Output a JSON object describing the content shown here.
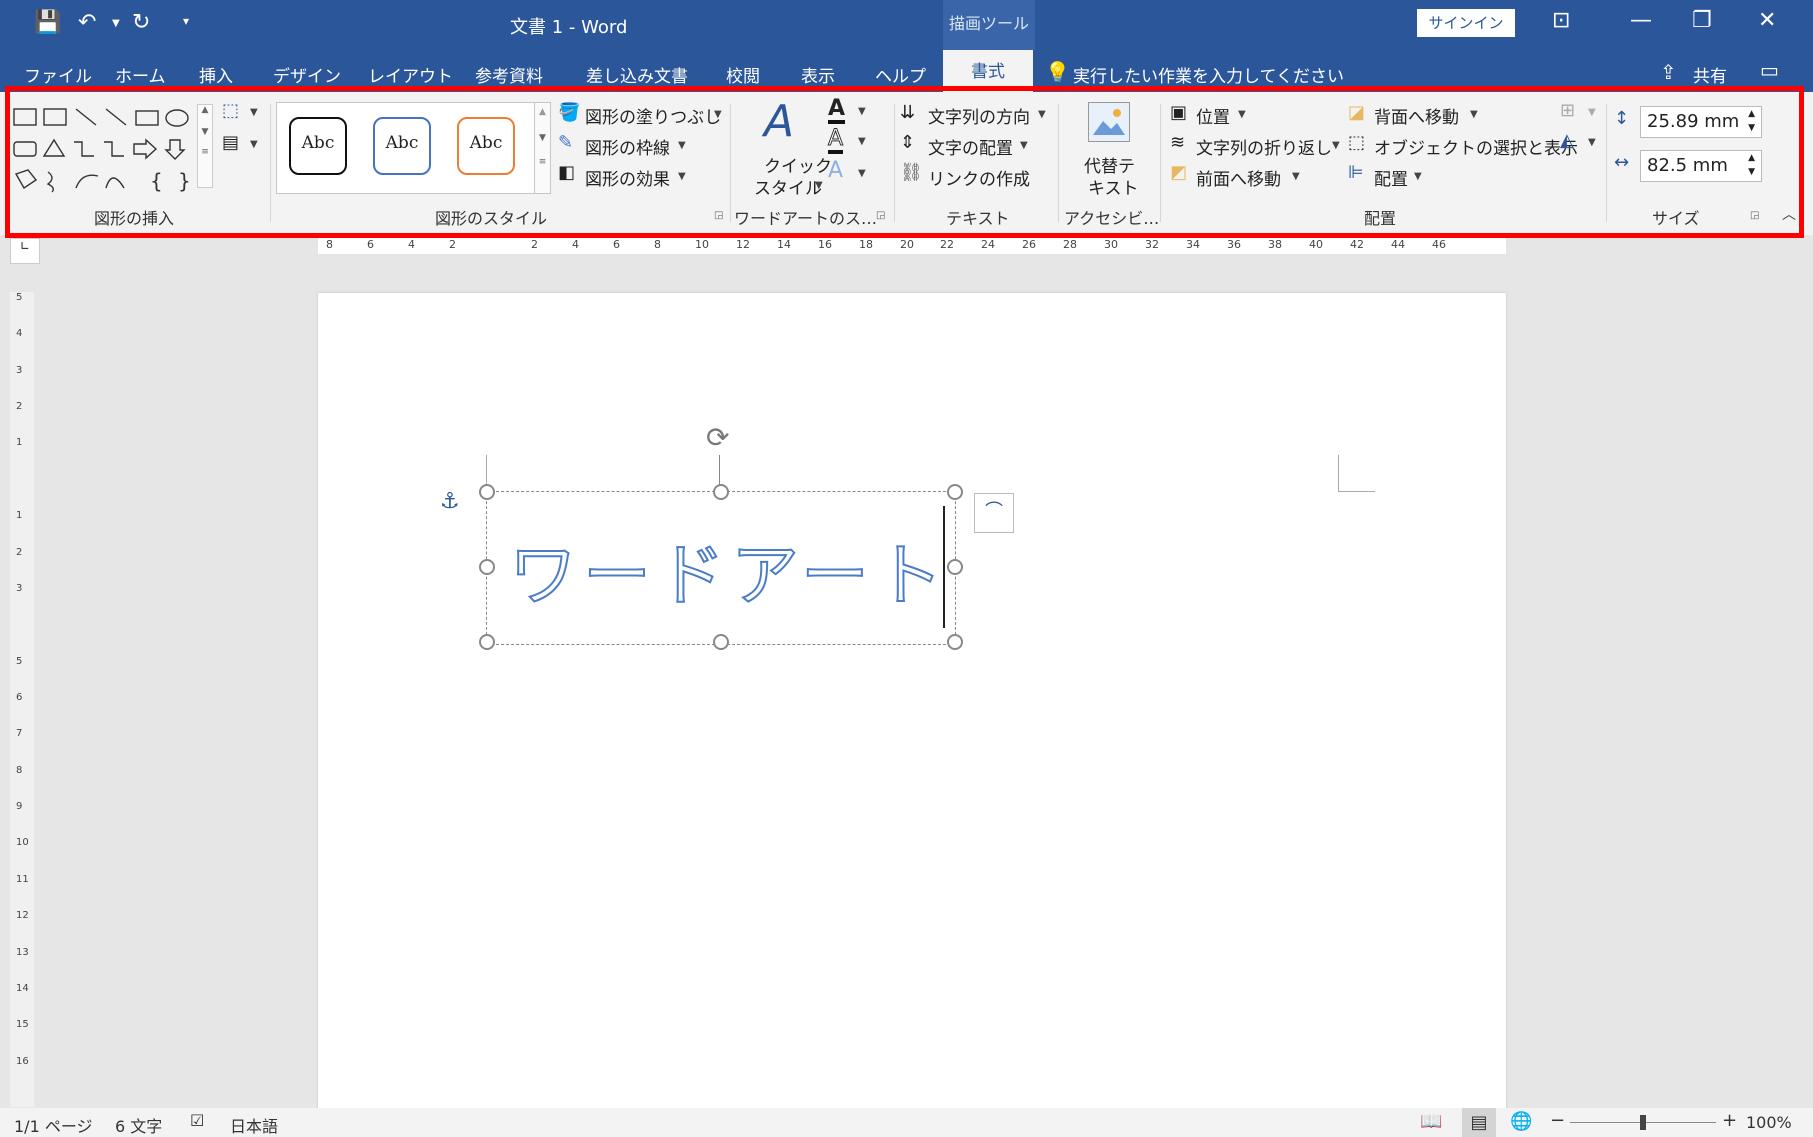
{
  "title": "文書 1  -  Word",
  "context_tab": "描画ツール",
  "signin_label": "サインイン",
  "tabs": [
    "ファイル",
    "ホーム",
    "挿入",
    "デザイン",
    "レイアウト",
    "参考資料",
    "差し込み文書",
    "校閲",
    "表示",
    "ヘルプ",
    "書式"
  ],
  "tell_me": "実行したい作業を入力してください",
  "share_label": "共有",
  "ribbon": {
    "insert_shapes_label": "図形の挿入",
    "shape_styles_label": "図形のスタイル",
    "shape_style_sample": "Abc",
    "fill_label": "図形の塗りつぶし",
    "outline_label": "図形の枠線",
    "effects_label": "図形の効果",
    "wordart_label": "ワードアートのス…",
    "quick_style_l1": "クイック",
    "quick_style_l2": "スタイル",
    "text_direction_label": "文字列の方向",
    "text_align_label": "文字の配置",
    "link_label": "リンクの作成",
    "text_group_label": "テキスト",
    "alt_text_l1": "代替テ",
    "alt_text_l2": "キスト",
    "accessibility_label": "アクセシビ…",
    "position_label": "位置",
    "wrap_label": "文字列の折り返し",
    "forward_label": "前面へ移動",
    "backward_label": "背面へ移動",
    "selection_pane_label": "オブジェクトの選択と表示",
    "align_label": "配置",
    "arrange_group_label": "配置",
    "height_value": "25.89 mm",
    "width_value": "82.5 mm",
    "size_group_label": "サイズ"
  },
  "hruler_ticks": [
    "8",
    "6",
    "4",
    "2",
    "",
    "2",
    "4",
    "6",
    "8",
    "10",
    "12",
    "14",
    "16",
    "18",
    "20",
    "22",
    "24",
    "26",
    "28",
    "30",
    "32",
    "34",
    "36",
    "38",
    "40",
    "42",
    "44",
    "46"
  ],
  "vruler_ticks": [
    "5",
    "4",
    "3",
    "2",
    "1",
    "",
    "1",
    "2",
    "3",
    "",
    "5",
    "6",
    "7",
    "8",
    "9",
    "10",
    "11",
    "12",
    "13",
    "14",
    "15",
    "16"
  ],
  "wordart_text": "ワードアート",
  "status": {
    "page": "1/1 ページ",
    "words": "6 文字",
    "language": "日本語",
    "zoom": "100%"
  },
  "colors": {
    "title_bar": "#2b579a",
    "highlight": "#ff0000",
    "wordart_outline": "#4a7cc8"
  }
}
